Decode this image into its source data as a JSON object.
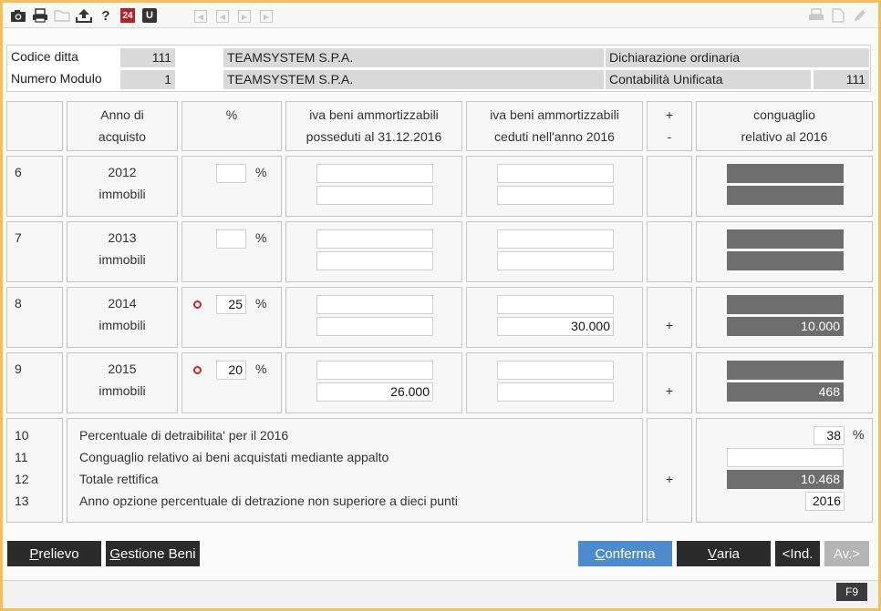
{
  "toolbar": {
    "icons": [
      "camera-icon",
      "printer-icon",
      "folder-icon",
      "upload-icon",
      "help-icon",
      "calendar-24-icon",
      "u-icon"
    ],
    "help_glyph": "?",
    "badge_24": "24",
    "badge_u": "U",
    "nav": [
      "first-icon",
      "prev-icon",
      "next-icon",
      "last-icon"
    ]
  },
  "header": {
    "codice_ditta_label": "Codice ditta",
    "codice_ditta_value": "111",
    "company_1": "TEAMSYSTEM S.P.A.",
    "dichiarazione": "Dichiarazione ordinaria",
    "numero_modulo_label": "Numero Modulo",
    "numero_modulo_value": "1",
    "company_2": "TEAMSYSTEM S.P.A.",
    "contabilita": "Contabilità Unificata",
    "contabilita_value": "111"
  },
  "columns": {
    "anno_1": "Anno di",
    "anno_2": "acquisto",
    "perc": "%",
    "posseduti_1": "iva beni ammortizzabili",
    "posseduti_2": "posseduti al 31.12.2016",
    "ceduti_1": "iva beni ammortizzabili",
    "ceduti_2": "ceduti nell'anno 2016",
    "sign_plus": "+",
    "sign_minus": "-",
    "conguaglio_1": "conguaglio",
    "conguaglio_2": "relativo al 2016"
  },
  "rows": [
    {
      "num": "6",
      "year": "2012",
      "type": "immobili",
      "perc": "",
      "perc_sign": "%",
      "poss_1": "",
      "poss_2": "",
      "ced_1": "",
      "ced_2": "",
      "sign": "",
      "cong_1": "",
      "cong_2": ""
    },
    {
      "num": "7",
      "year": "2013",
      "type": "immobili",
      "perc": "",
      "perc_sign": "%",
      "poss_1": "",
      "poss_2": "",
      "ced_1": "",
      "ced_2": "",
      "sign": "",
      "cong_1": "",
      "cong_2": ""
    },
    {
      "num": "8",
      "year": "2014",
      "type": "immobili",
      "perc": "25",
      "perc_sign": "%",
      "poss_1": "",
      "poss_2": "",
      "ced_1": "",
      "ced_2": "30.000",
      "sign": "+",
      "cong_1": "",
      "cong_2": "10.000"
    },
    {
      "num": "9",
      "year": "2015",
      "type": "immobili",
      "perc": "20",
      "perc_sign": "%",
      "poss_1": "",
      "poss_2": "26.000",
      "ced_1": "",
      "ced_2": "",
      "sign": "+",
      "cong_1": "",
      "cong_2": "468"
    }
  ],
  "summary": {
    "n10": "10",
    "l10": "Percentuale di detraibilita' per il 2016",
    "v10": "38",
    "v10_sign": "%",
    "n11": "11",
    "l11": "Conguaglio relativo ai beni acquistati mediante appalto",
    "v11": "",
    "n12": "12",
    "l12": "Totale rettifica",
    "v12": "10.468",
    "sign12": "+",
    "n13": "13",
    "l13": "Anno opzione percentuale di detrazione non superiore a dieci punti",
    "v13": "2016"
  },
  "buttons": {
    "prelievo_first": "P",
    "prelievo_rest": "relievo",
    "gestione_first": "G",
    "gestione_rest": "estione Beni",
    "conferma_first": "C",
    "conferma_rest": "onferma",
    "varia_first": "V",
    "varia_rest": "aria",
    "ind": "<Ind.",
    "av": "Av.>"
  },
  "status": {
    "f9": "F9"
  }
}
